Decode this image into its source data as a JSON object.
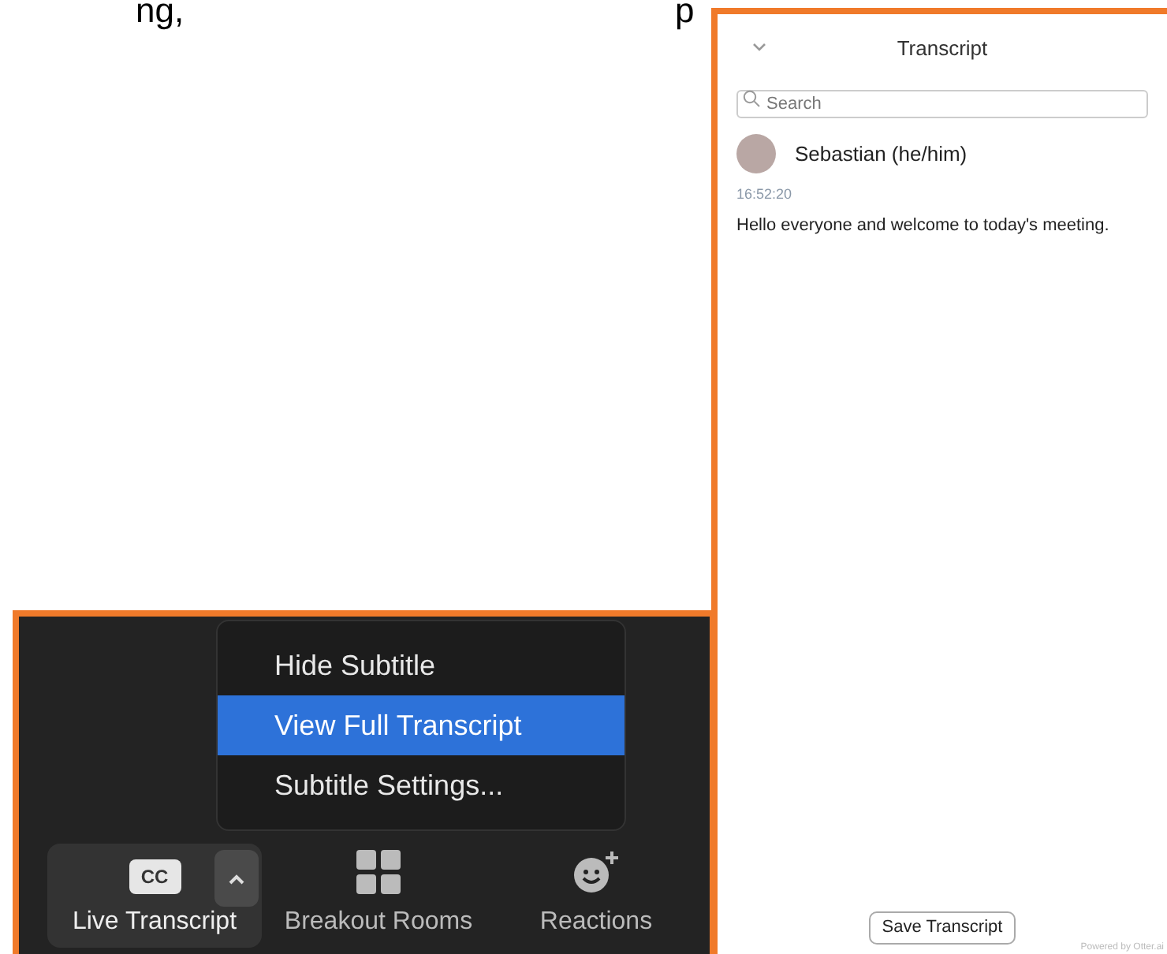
{
  "heading_fragments": [
    "ng,",
    "p"
  ],
  "meeting_panel": {
    "menu": [
      {
        "label": "Hide Subtitle",
        "selected": false
      },
      {
        "label": "View Full Transcript",
        "selected": true
      },
      {
        "label": "Subtitle Settings...",
        "selected": false
      }
    ],
    "toolbar": [
      {
        "kind": "captions",
        "label": "Live Transcript",
        "badge": "CC",
        "active": true
      },
      {
        "kind": "grid",
        "label": "Breakout Rooms",
        "active": false
      },
      {
        "kind": "reactions",
        "label": "Reactions",
        "active": false
      }
    ]
  },
  "transcript_panel": {
    "title": "Transcript",
    "search": {
      "placeholder": "Search"
    },
    "entries": [
      {
        "speaker": "Sebastian (he/him)",
        "time": "16:52:20",
        "text": "Hello everyone and welcome to today's meeting."
      }
    ],
    "save_button": "Save Transcript",
    "footer": "Powered by Otter.ai"
  }
}
